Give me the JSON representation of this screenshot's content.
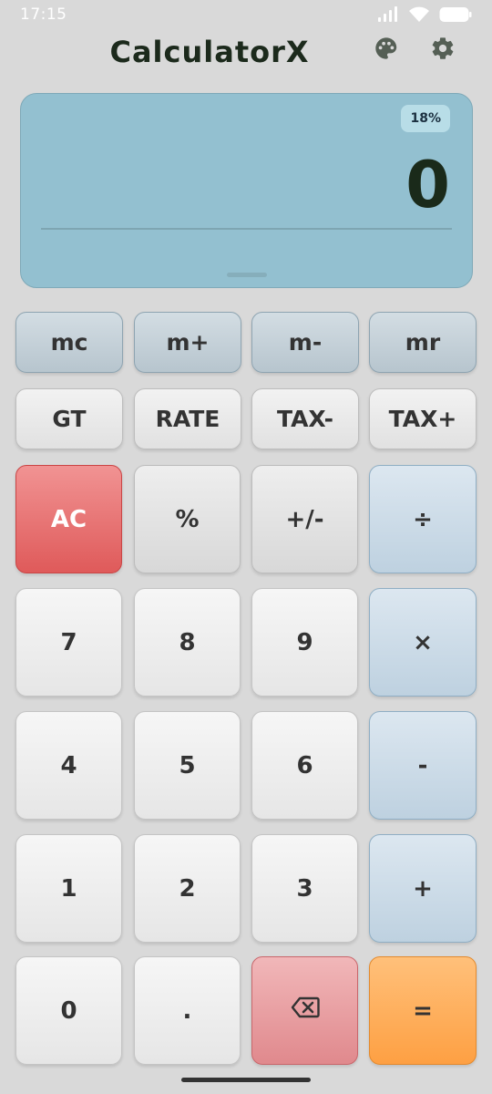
{
  "status_bar": {
    "time": "17:15",
    "icons": [
      "signal-icon",
      "wifi-icon",
      "battery-icon"
    ]
  },
  "header": {
    "title": "CalculatorX",
    "icons": [
      "palette-icon",
      "gear-icon"
    ]
  },
  "display": {
    "tax_rate": "18%",
    "value": "0"
  },
  "memory_row": [
    "mc",
    "m+",
    "m-",
    "mr"
  ],
  "function_row": [
    "GT",
    "RATE",
    "TAX-",
    "TAX+"
  ],
  "keys": {
    "ac": "AC",
    "percent": "%",
    "sign": "+/-",
    "divide": "÷",
    "seven": "7",
    "eight": "8",
    "nine": "9",
    "multiply": "×",
    "four": "4",
    "five": "5",
    "six": "6",
    "minus": "-",
    "one": "1",
    "two": "2",
    "three": "3",
    "plus": "+",
    "zero": "0",
    "decimal": ".",
    "equals": "="
  },
  "colors": {
    "display_bg": "#93c0d0",
    "clear_key": "#e86a6a",
    "operator_key": "#c9d9e6",
    "backspace_key": "#e8989b",
    "equals_key": "#ffab55"
  }
}
